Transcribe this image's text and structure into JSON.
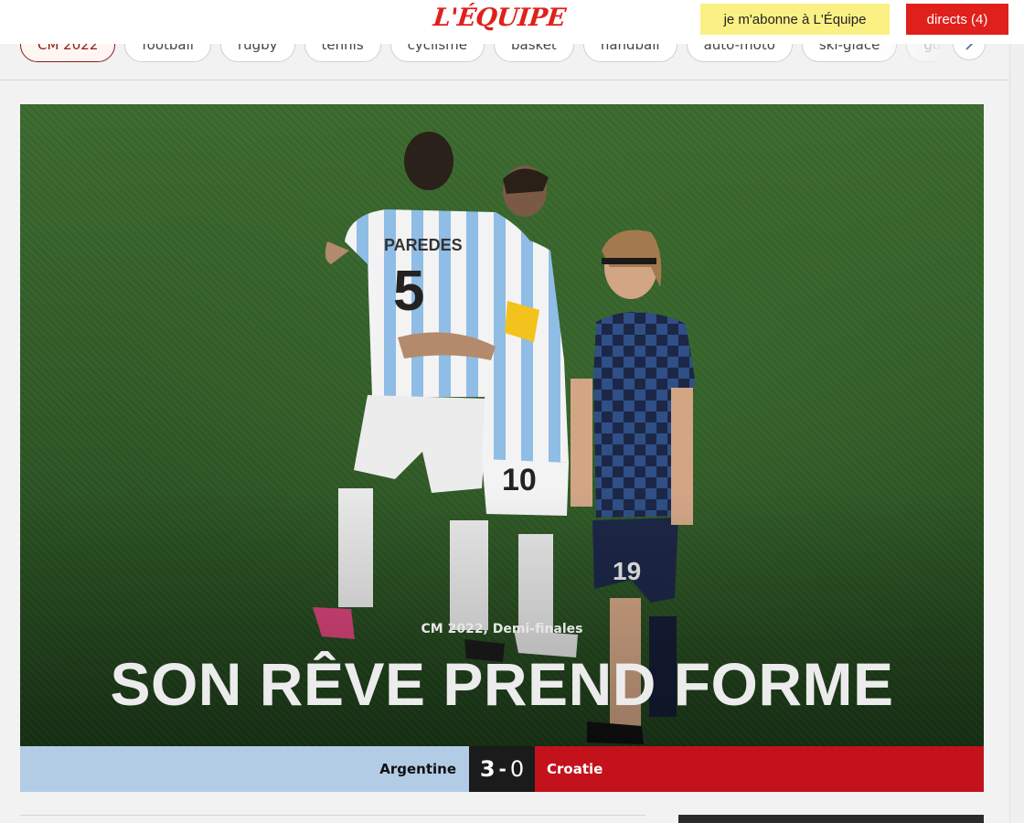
{
  "header": {
    "logo": "L'ÉQUIPE",
    "subscribe_label": "je m'abonne à L'Équipe",
    "live_label": "directs (4)"
  },
  "nav": {
    "items": [
      {
        "label": "CM 2022",
        "active": true
      },
      {
        "label": "football"
      },
      {
        "label": "rugby"
      },
      {
        "label": "tennis"
      },
      {
        "label": "cyclisme"
      },
      {
        "label": "basket"
      },
      {
        "label": "handball"
      },
      {
        "label": "auto-moto"
      },
      {
        "label": "ski-glace"
      },
      {
        "label": "golf"
      }
    ],
    "next_icon": "chevron-right-icon"
  },
  "hero": {
    "kicker": "CM 2022,  Demi-finales",
    "title": "SON RÊVE PREND FORME",
    "jersey_home_name": "PAREDES",
    "jersey_home_number": "5",
    "jersey_messi_number": "10",
    "jersey_away_number": "19"
  },
  "match": {
    "home_team": "Argentine",
    "home_goals": "3",
    "separator": "-",
    "away_goals": "0",
    "away_team": "Croatie"
  },
  "colors": {
    "brand_red": "#e0201b",
    "subscribe_yellow": "#fbf084",
    "home_color": "#b3cce6",
    "away_color": "#c4121c"
  }
}
